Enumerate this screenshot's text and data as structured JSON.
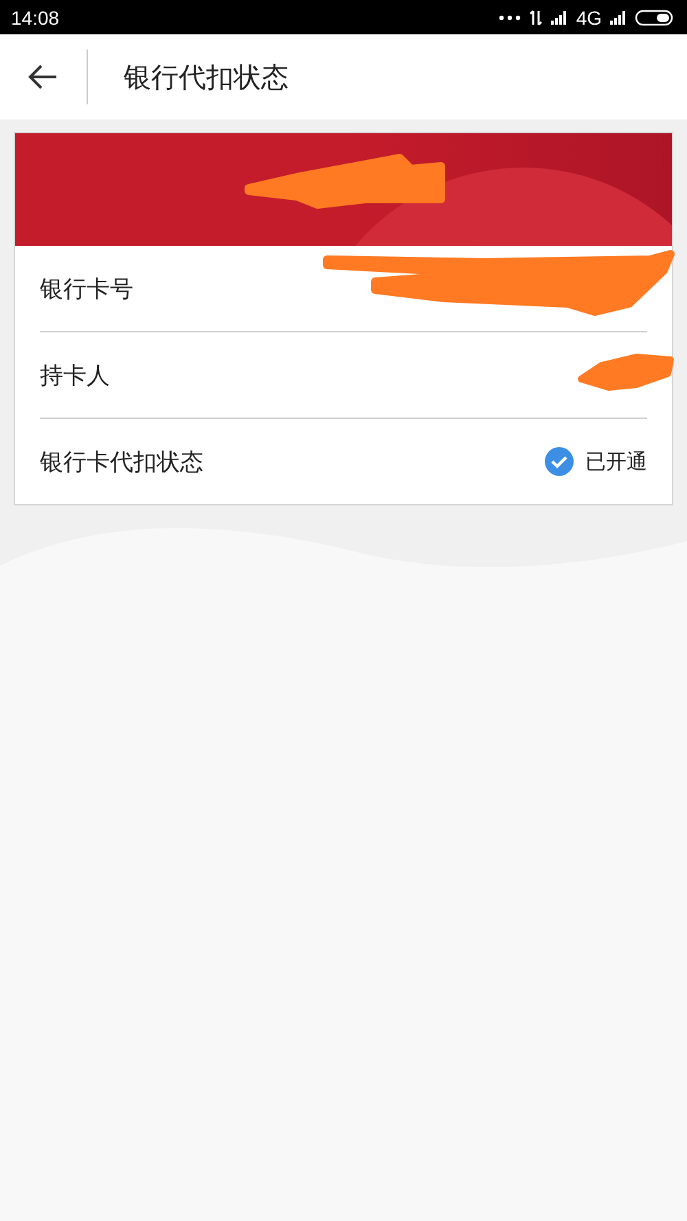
{
  "status_bar": {
    "time": "14:08",
    "network": "4G"
  },
  "header": {
    "title": "银行代扣状态"
  },
  "card": {
    "rows": [
      {
        "kind": "redacted",
        "label": "银行卡号"
      },
      {
        "kind": "redacted",
        "label": "持卡人"
      },
      {
        "kind": "status",
        "label": "银行卡代扣状态",
        "value": "已开通",
        "checked": true
      }
    ]
  }
}
